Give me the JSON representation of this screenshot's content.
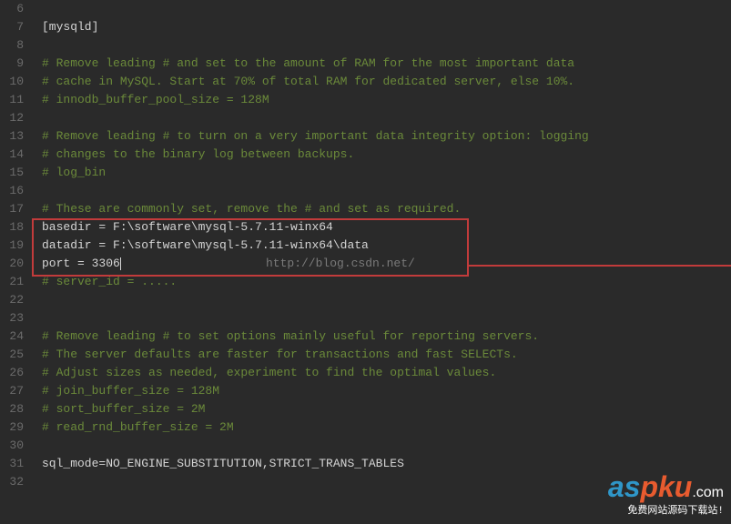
{
  "gutter": [
    "6",
    "7",
    "8",
    "9",
    "10",
    "11",
    "12",
    "13",
    "14",
    "15",
    "16",
    "17",
    "18",
    "19",
    "20",
    "21",
    "22",
    "23",
    "24",
    "25",
    "26",
    "27",
    "28",
    "29",
    "30",
    "31",
    "32"
  ],
  "lines": {
    "l6": "",
    "l7": "[mysqld]",
    "l8": "",
    "l9": "# Remove leading # and set to the amount of RAM for the most important data",
    "l10": "# cache in MySQL. Start at 70% of total RAM for dedicated server, else 10%.",
    "l11": "# innodb_buffer_pool_size = 128M",
    "l12": "",
    "l13": "# Remove leading # to turn on a very important data integrity option: logging",
    "l14": "# changes to the binary log between backups.",
    "l15": "# log_bin",
    "l16": "",
    "l17": "# These are commonly set, remove the # and set as required.",
    "l18": "basedir = F:\\software\\mysql-5.7.11-winx64",
    "l19": "datadir = F:\\software\\mysql-5.7.11-winx64\\data",
    "l20": "port = 3306",
    "l21": "# server_id = .....",
    "l22": "",
    "l23": "",
    "l24": "# Remove leading # to set options mainly useful for reporting servers.",
    "l25": "# The server defaults are faster for transactions and fast SELECTs.",
    "l26": "# Adjust sizes as needed, experiment to find the optimal values.",
    "l27": "# join_buffer_size = 128M",
    "l28": "# sort_buffer_size = 2M",
    "l29": "# read_rnd_buffer_size = 2M",
    "l30": "",
    "l31": "sql_mode=NO_ENGINE_SUBSTITUTION,STRICT_TRANS_TABLES",
    "l32": ""
  },
  "watermark_url": "http://blog.csdn.net/",
  "logo": {
    "a": "a",
    "s": "s",
    "p": "p",
    "k": "k",
    "u": "u",
    "dot": ".com",
    "sub": "免费网站源码下载站!"
  }
}
